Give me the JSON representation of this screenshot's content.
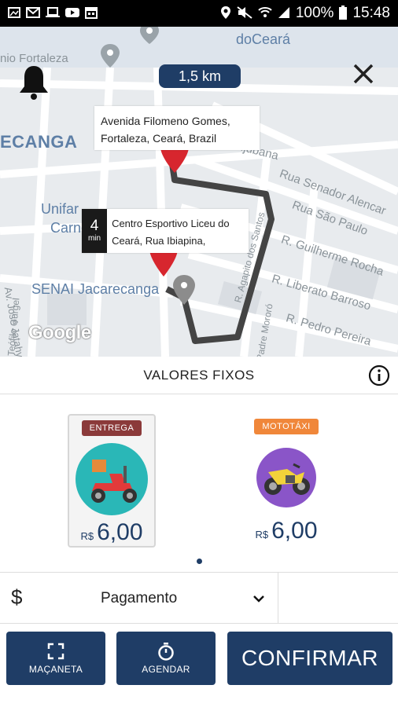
{
  "status_bar": {
    "battery": "100%",
    "time": "15:48"
  },
  "map": {
    "distance": "1,5 km",
    "origin_address": "Avenida Filomeno Gomes, Fortaleza, Ceará, Brazil",
    "eta_value": "4",
    "eta_unit": "min",
    "destination_address": "Centro Esportivo Liceu do Ceará, Rua Ibiapina,",
    "labels": {
      "l1": "nio Fortaleza",
      "l2": "doCeará",
      "l3": "ECANGA",
      "l4": "R. Tijubana",
      "l5": "Rua Senador Alencar",
      "l6": "Rua São Paulo",
      "l7": "R. Guilherme Rocha",
      "l8": "R. Liberato Barroso",
      "l9": "R. Pedro Pereira",
      "l10": "Unifar",
      "l11": "Carneiro da Cunha",
      "l12": "SENAI Jacarecanga",
      "l13": "Av. José Jatahy",
      "l14": "Teófilo Gurgel",
      "l15": "R. Agapito dos Santos",
      "l16": "Padre Mororó"
    },
    "google_logo": "Google"
  },
  "values": {
    "title": "VALORES FIXOS"
  },
  "services": [
    {
      "badge": "ENTREGA",
      "badge_color": "#8b3a3a",
      "currency": "R$",
      "amount": "6,00",
      "icon": "scooter-icon"
    },
    {
      "badge": "MOTOTÁXI",
      "badge_color": "#f0873a",
      "currency": "R$",
      "amount": "6,00",
      "icon": "motorcycle-icon"
    }
  ],
  "payment": {
    "label": "Pagamento",
    "icon": "$"
  },
  "buttons": {
    "handle": "MAÇANETA",
    "schedule": "AGENDAR",
    "confirm": "CONFIRMAR"
  },
  "colors": {
    "primary": "#1f3d66",
    "route": "#444444",
    "pin": "#d7262e"
  }
}
